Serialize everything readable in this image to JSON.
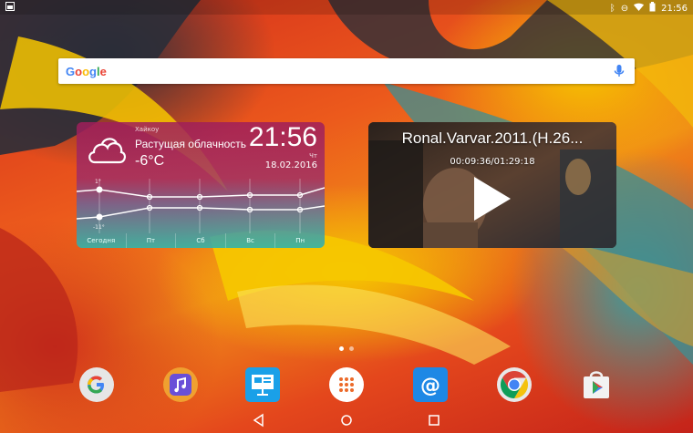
{
  "status_bar": {
    "time": "21:56",
    "icons": [
      "notification-icon",
      "bluetooth-icon",
      "do-not-disturb-icon",
      "wifi-icon",
      "battery-icon"
    ]
  },
  "search_widget": {
    "logo_text": "Google",
    "logo_colors": [
      "#4285F4",
      "#EA4335",
      "#FBBC05",
      "#4285F4",
      "#34A853",
      "#EA4335"
    ],
    "mic_color": "#4285F4"
  },
  "weather_widget": {
    "city": "Хайкоу",
    "condition": "Растущая облачность",
    "temperature": "-6°C",
    "clock": "21:56",
    "day_of_week": "Чт",
    "date": "18.02.2016",
    "graph_high_label": "1°",
    "graph_low_label": "-11°",
    "days": [
      "Сегодня",
      "Пт",
      "Сб",
      "Вс",
      "Пн"
    ]
  },
  "video_widget": {
    "title": "Ronal.Varvar.2011.(H.26...",
    "time": "00:09:36/01:29:18"
  },
  "page_indicator": {
    "pages": 2,
    "active": 0
  },
  "dock": {
    "apps": [
      {
        "name": "google-app-icon"
      },
      {
        "name": "music-app-icon"
      },
      {
        "name": "presentation-app-icon"
      },
      {
        "name": "all-apps-icon"
      },
      {
        "name": "email-app-icon"
      },
      {
        "name": "chrome-app-icon"
      },
      {
        "name": "play-store-icon"
      }
    ]
  },
  "nav_bar": {
    "buttons": [
      "back-icon",
      "home-icon",
      "recents-icon"
    ]
  },
  "colors": {
    "accent_email": "#1e88e5",
    "accent_presentation": "#1aa0e8",
    "accent_music": "#6a4fd8"
  }
}
